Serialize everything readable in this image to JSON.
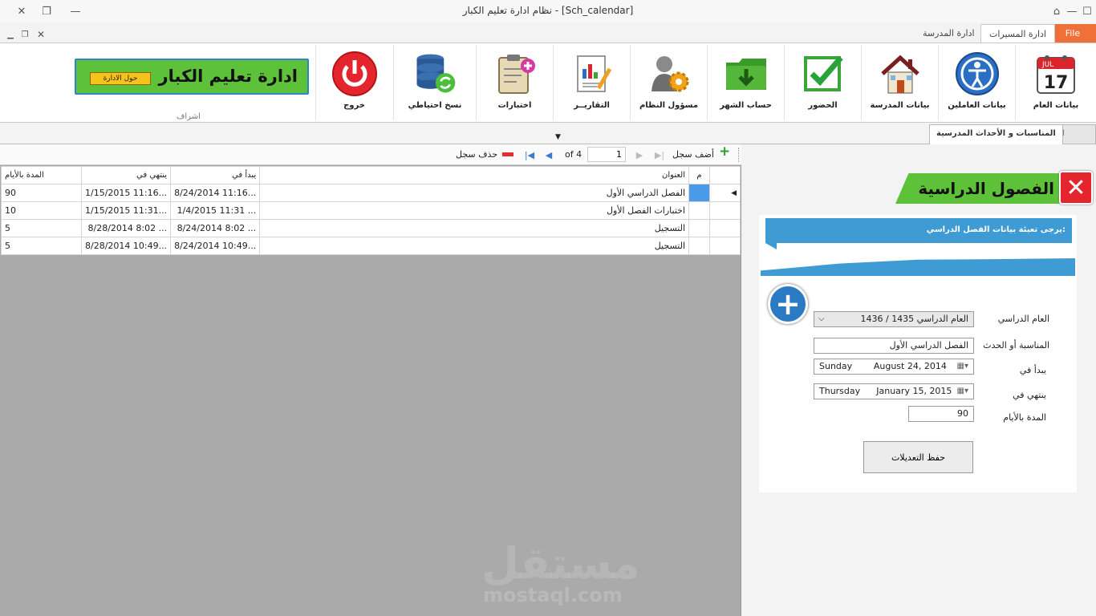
{
  "window": {
    "title": "نظام ادارة تعليم الكبار - [Sch_calendar]"
  },
  "ribbon_tabs": [
    {
      "label": "File"
    },
    {
      "label": "ادارة المسيرات"
    },
    {
      "label": "ادارة المدرسة"
    }
  ],
  "ribbon": {
    "buttons": [
      {
        "label": "بيانات العام",
        "icon": "calendar-icon",
        "calendar_month": "JUL",
        "calendar_day": "17"
      },
      {
        "label": "بيانات العاملين",
        "icon": "person-circle-icon"
      },
      {
        "label": "بيانات المدرسة",
        "icon": "house-icon"
      },
      {
        "label": "الحضور",
        "icon": "checkmark-icon"
      },
      {
        "label": "حساب الشهر",
        "icon": "green-folder-icon"
      },
      {
        "label": "مسؤول النظام",
        "icon": "admin-gear-icon"
      },
      {
        "label": "التقاريــر",
        "icon": "report-chart-icon"
      },
      {
        "label": "اختبارات",
        "icon": "exam-clipboard-icon"
      },
      {
        "label": "نسخ احتياطي",
        "icon": "database-backup-icon"
      },
      {
        "label": "خروج",
        "icon": "power-icon"
      }
    ],
    "banner_title": "ادارة تعليم الكبار",
    "banner_button": "حول الادارة",
    "group_label": "اشراف"
  },
  "sub_tabs": [
    {
      "label": "الأعوام الدراسية"
    },
    {
      "label": "المناسبات و الأحداث المدرسية"
    }
  ],
  "navigator": {
    "add_label": "أضف سجل",
    "delete_label": "حذف سجل",
    "current_page": "1",
    "of_label": "of 4"
  },
  "grid": {
    "columns": [
      "م",
      "العنوان",
      "يبدأ في",
      "ينتهي في",
      "المدة بالأيام"
    ],
    "rows": [
      {
        "title": "الفصل الدراسي الأول",
        "start": "8/24/2014 11:16...",
        "end": "1/15/2015 11:16...",
        "days": "90"
      },
      {
        "title": "اختبارات الفصل الأول",
        "start": "1/4/2015 11:31 ...",
        "end": "1/15/2015 11:31...",
        "days": "10"
      },
      {
        "title": "التسجيل",
        "start": "8/24/2014 8:02 ...",
        "end": "8/28/2014 8:02 ...",
        "days": "5"
      },
      {
        "title": "التسجيل",
        "start": "8/24/2014 10:49...",
        "end": "8/28/2014 10:49...",
        "days": "5"
      }
    ]
  },
  "form": {
    "header": "الفصول الدراسية",
    "info": "يرجى تعبئة بيانات الفصل الدراسي:",
    "year_label": "العام الدراسي",
    "year_value": "العام الدراسي 1435 / 1436",
    "event_label": "المناسبة أو الحدث",
    "event_value": "الفصل الدراسي الأول",
    "start_label": "يبدأ في",
    "start_day": "Sunday",
    "start_date": "August   24, 2014",
    "end_label": "ينتهي في",
    "end_day": "Thursday",
    "end_date": "January   15, 2015",
    "days_label": "المدة بالأيام",
    "days_value": "90",
    "save_label": "حفظ التعديلات"
  },
  "watermark": {
    "arabic": "مستقل",
    "latin": "mostaql.com"
  },
  "colors": {
    "file_tab": "#f0703a",
    "banner_green": "#5ec13a",
    "info_blue": "#3f9bd3",
    "close_red": "#e5252d",
    "grid_background": "#aaaaaa"
  }
}
